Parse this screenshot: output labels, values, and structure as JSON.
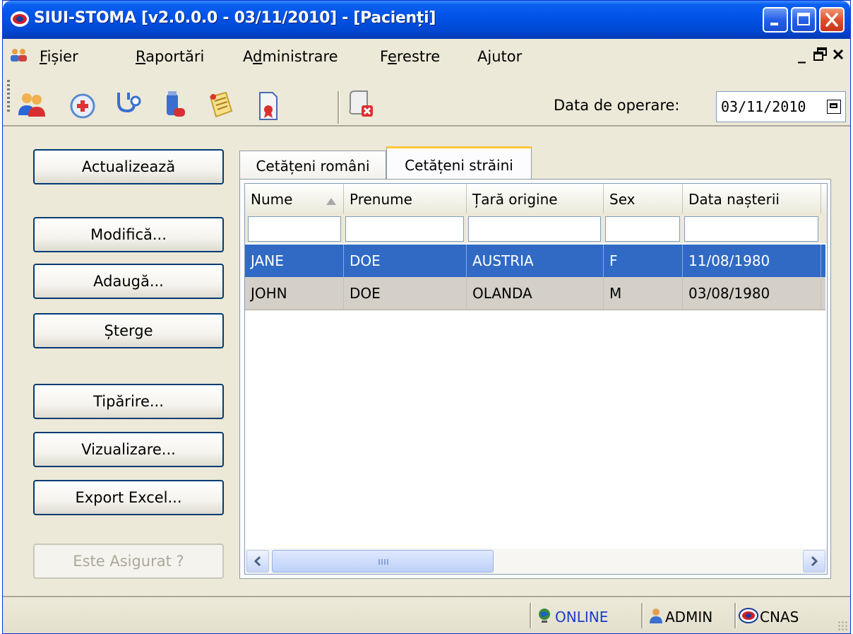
{
  "window": {
    "title": "SIUI-STOMA [v2.0.0.0 - 03/11/2010] - [Pacienți]"
  },
  "menu": {
    "items": [
      {
        "label": "Fișier",
        "accel": "F",
        "rest": "ișier"
      },
      {
        "label": "Raportări",
        "accel": "R",
        "rest": "aportări"
      },
      {
        "label": "Administrare",
        "accel": "d",
        "pre": "A",
        "rest": "ministrare"
      },
      {
        "label": "Ferestre",
        "accel": "e",
        "pre": "F",
        "rest": "restre"
      },
      {
        "label": "Ajutor",
        "accel": "j",
        "pre": "A",
        "rest": "utor"
      }
    ]
  },
  "toolbar": {
    "icons": [
      "patients-icon",
      "first-aid-icon",
      "stethoscope-icon",
      "medicine-bottle-icon",
      "notes-icon",
      "certificate-document-icon",
      "delete-document-icon"
    ],
    "date_label": "Data de operare:",
    "date_value": "03/11/2010"
  },
  "actions": {
    "refresh": "Actualizează",
    "modify": "Modifică...",
    "add": "Adaugă...",
    "delete": "Șterge",
    "print": "Tipărire...",
    "preview": "Vizualizare...",
    "export": "Export Excel...",
    "insured": "Este Asigurat ?"
  },
  "tabs": {
    "romanian": "Cetățeni români",
    "foreign": "Cetățeni străini",
    "active": "foreign"
  },
  "grid": {
    "columns": [
      "Nume",
      "Prenume",
      "Țară origine",
      "Sex",
      "Data nașterii"
    ],
    "sorted_column": "Nume",
    "rows": [
      [
        "JANE",
        "DOE",
        "AUSTRIA",
        "F",
        "11/08/1980"
      ],
      [
        "JOHN",
        "DOE",
        "OLANDA",
        "M",
        "03/08/1980"
      ]
    ],
    "selected_row": 0
  },
  "status": {
    "connection": "ONLINE",
    "user": "ADMIN",
    "org": "CNAS"
  },
  "colors": {
    "titlebar": "#0052e6",
    "selection": "#316ac5",
    "status_online": "#1a3cc8"
  }
}
